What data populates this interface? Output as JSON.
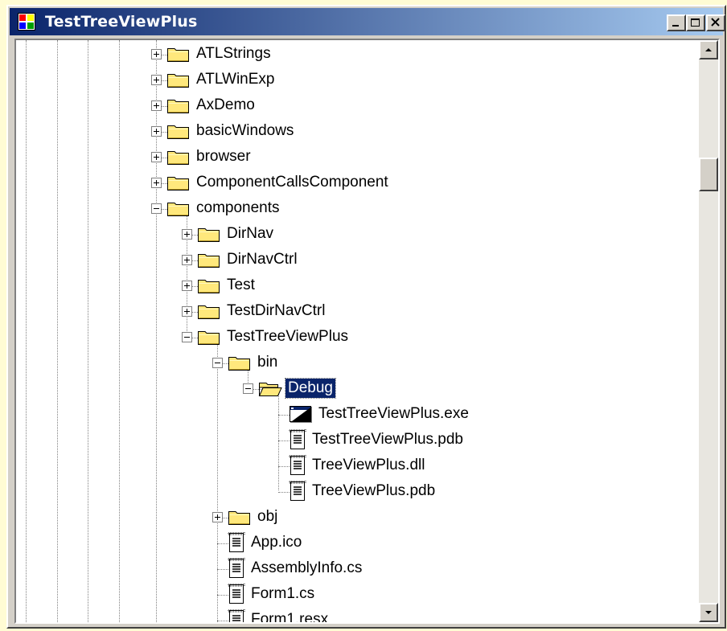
{
  "window": {
    "title": "TestTreeViewPlus",
    "app_icon": "window-app-icon",
    "buttons": [
      "minimize",
      "maximize",
      "close"
    ]
  },
  "colors": {
    "titlebar_start": "#0a246a",
    "titlebar_end": "#a6caf0",
    "selection": "#0a246a",
    "folder": "#ffe87c",
    "backdrop": "#fffcd4"
  },
  "tree": {
    "items": [
      {
        "label": "ATLStrings",
        "depth": 0,
        "icon": "folder-closed-icon",
        "expander": "plus"
      },
      {
        "label": "ATLWinExp",
        "depth": 0,
        "icon": "folder-closed-icon",
        "expander": "plus"
      },
      {
        "label": "AxDemo",
        "depth": 0,
        "icon": "folder-closed-icon",
        "expander": "plus"
      },
      {
        "label": "basicWindows",
        "depth": 0,
        "icon": "folder-closed-icon",
        "expander": "plus"
      },
      {
        "label": "browser",
        "depth": 0,
        "icon": "folder-closed-icon",
        "expander": "plus"
      },
      {
        "label": "ComponentCallsComponent",
        "depth": 0,
        "icon": "folder-closed-icon",
        "expander": "plus"
      },
      {
        "label": "components",
        "depth": 0,
        "icon": "folder-closed-icon",
        "expander": "minus"
      },
      {
        "label": "DirNav",
        "depth": 1,
        "icon": "folder-closed-icon",
        "expander": "plus"
      },
      {
        "label": "DirNavCtrl",
        "depth": 1,
        "icon": "folder-closed-icon",
        "expander": "plus"
      },
      {
        "label": "Test",
        "depth": 1,
        "icon": "folder-closed-icon",
        "expander": "plus"
      },
      {
        "label": "TestDirNavCtrl",
        "depth": 1,
        "icon": "folder-closed-icon",
        "expander": "plus"
      },
      {
        "label": "TestTreeViewPlus",
        "depth": 1,
        "icon": "folder-closed-icon",
        "expander": "minus"
      },
      {
        "label": "bin",
        "depth": 2,
        "icon": "folder-closed-icon",
        "expander": "minus"
      },
      {
        "label": "Debug",
        "depth": 3,
        "icon": "folder-open-icon",
        "expander": "minus",
        "selected": true
      },
      {
        "label": "TestTreeViewPlus.exe",
        "depth": 4,
        "icon": "exe-window-icon",
        "expander": "none"
      },
      {
        "label": "TestTreeViewPlus.pdb",
        "depth": 4,
        "icon": "text-file-icon",
        "expander": "none"
      },
      {
        "label": "TreeViewPlus.dll",
        "depth": 4,
        "icon": "text-file-icon",
        "expander": "none"
      },
      {
        "label": "TreeViewPlus.pdb",
        "depth": 4,
        "icon": "text-file-icon",
        "expander": "none"
      },
      {
        "label": "obj",
        "depth": 2,
        "icon": "folder-closed-icon",
        "expander": "plus"
      },
      {
        "label": "App.ico",
        "depth": 2,
        "icon": "text-file-icon",
        "expander": "none"
      },
      {
        "label": "AssemblyInfo.cs",
        "depth": 2,
        "icon": "text-file-icon",
        "expander": "none"
      },
      {
        "label": "Form1.cs",
        "depth": 2,
        "icon": "text-file-icon",
        "expander": "none"
      },
      {
        "label": "Form1.resx",
        "depth": 2,
        "icon": "text-file-icon",
        "expander": "none"
      }
    ]
  },
  "scrollbar": {
    "up_icon": "scroll-up-arrow-icon",
    "down_icon": "scroll-down-arrow-icon"
  }
}
